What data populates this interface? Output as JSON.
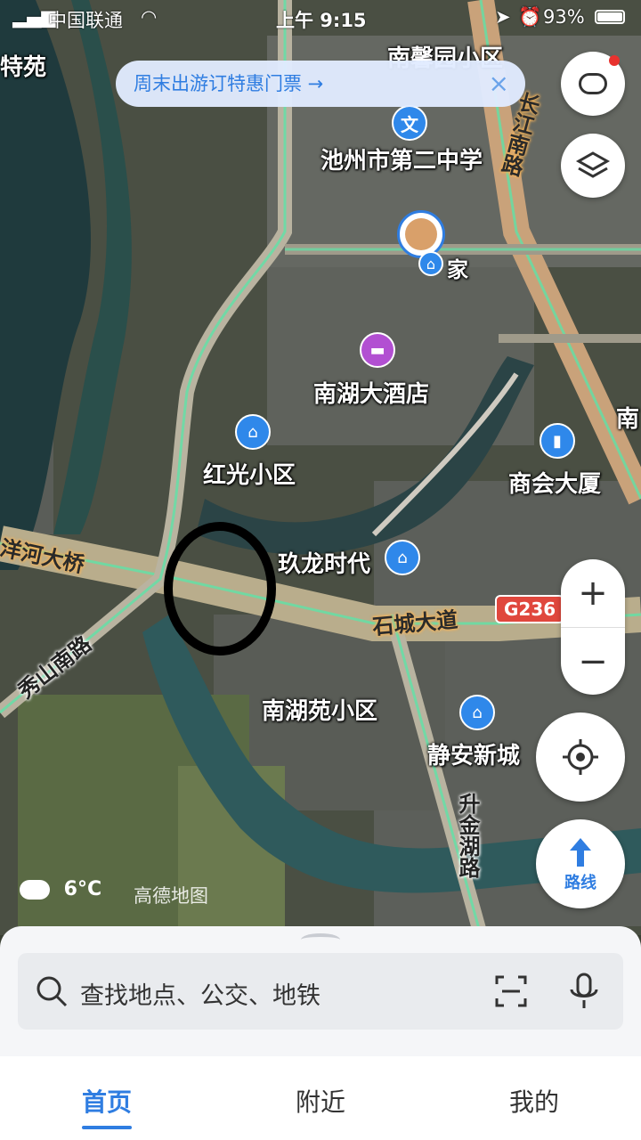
{
  "status_bar": {
    "carrier": "中国联通",
    "time": "上午 9:15",
    "battery": "93%"
  },
  "banner": {
    "text": "周末出游订特惠门票 →",
    "close": "×"
  },
  "map": {
    "pois": [
      {
        "name": "池州市第二中学",
        "icon": "school-icon"
      },
      {
        "name": "家",
        "icon": "home-icon"
      },
      {
        "name": "南湖大酒店",
        "icon": "hotel-icon"
      },
      {
        "name": "红光小区",
        "icon": "residence-icon"
      },
      {
        "name": "商会大厦",
        "icon": "building-icon"
      },
      {
        "name": "玖龙时代",
        "icon": "residence-icon"
      },
      {
        "name": "南湖苑小区",
        "icon": "none"
      },
      {
        "name": "静安新城",
        "icon": "residence-icon"
      },
      {
        "name": "南馨园小区",
        "icon": "none"
      },
      {
        "name": "特苑",
        "icon": "none"
      },
      {
        "name": "南",
        "icon": "none"
      }
    ],
    "roads": {
      "changjiang": "长江南路",
      "yanghe": "洋河大桥",
      "shicheng": "石城大道",
      "xiushan": "秀山南路",
      "shengjin": "升金湖路",
      "g236": "G236"
    },
    "zoom_in": "+",
    "zoom_out": "−",
    "route_label": "路线",
    "weather": "6°C",
    "watermark": "高德地图"
  },
  "search": {
    "placeholder": "查找地点、公交、地铁"
  },
  "tabs": [
    {
      "label": "首页",
      "active": true
    },
    {
      "label": "附近",
      "active": false
    },
    {
      "label": "我的",
      "active": false
    }
  ]
}
